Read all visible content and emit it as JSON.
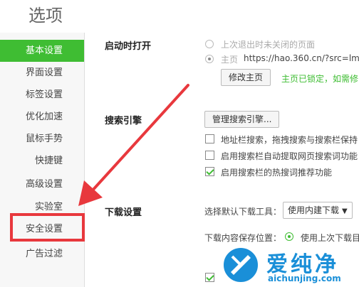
{
  "window": {
    "title": "选项"
  },
  "sidebar": {
    "items": [
      {
        "label": "基本设置",
        "active": true
      },
      {
        "label": "界面设置"
      },
      {
        "label": "标签设置"
      },
      {
        "label": "优化加速"
      },
      {
        "label": "鼠标手势"
      },
      {
        "label": "快捷键"
      },
      {
        "label": "高级设置"
      },
      {
        "label": "实验室"
      },
      {
        "label": "安全设置"
      },
      {
        "label": "广告过滤"
      }
    ]
  },
  "startup": {
    "label": "启动时打开",
    "opt_restore": "上次退出时未关闭的页面",
    "opt_home_prefix": "主页",
    "opt_home_url": "https://hao.360.cn/?src=lm",
    "modify_home_button": "修改主页",
    "locked_text": "主页已锁定，如需修"
  },
  "search": {
    "label": "搜索引擎",
    "manage_button": "管理搜索引擎...",
    "opt1": "地址栏搜索，拖拽搜索与搜索栏保持",
    "opt2": "启用搜索栏自动提取网页搜索词功能",
    "opt3": "启用搜索栏的热搜词推荐功能"
  },
  "download": {
    "label": "下载设置",
    "tool_label": "选择默认下载工具：",
    "tool_value": "使用内建下载",
    "save_label": "下载内容保存位置：",
    "save_option": "使用上次下载目"
  },
  "watermark": {
    "text_cn": "爱纯净",
    "text_url": "aichunjing.com"
  },
  "colors": {
    "accent": "#3fbd33",
    "annotation": "#e8383d",
    "watermark": "#1a8fd8"
  }
}
